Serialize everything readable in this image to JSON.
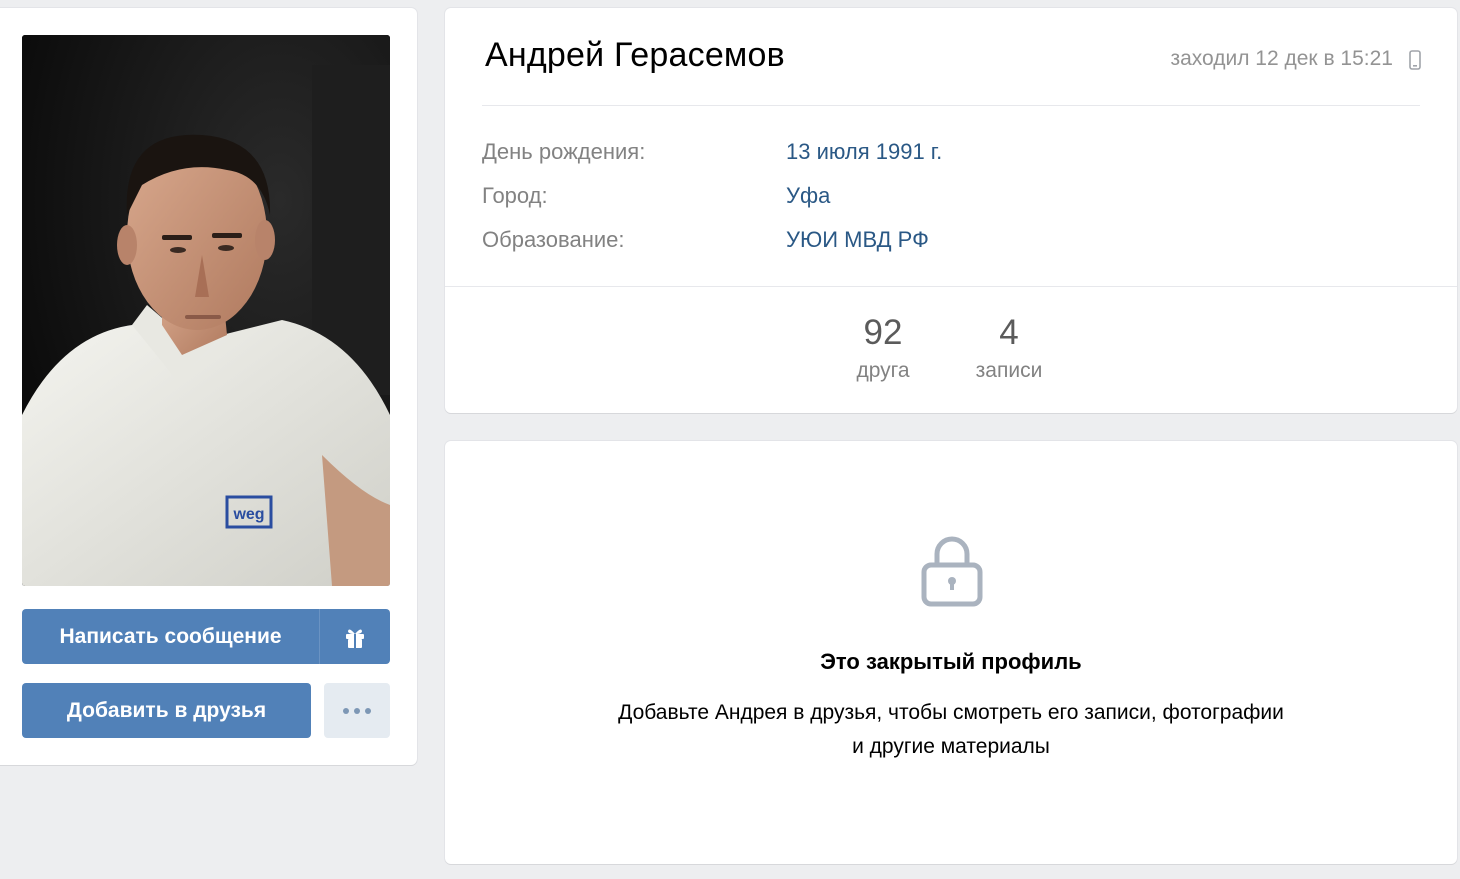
{
  "profile": {
    "name": "Андрей Герасемов",
    "last_seen": "заходил 12 дек в 15:21",
    "last_seen_device_icon": "mobile-phone-icon"
  },
  "info": [
    {
      "label": "День рождения:",
      "value": "13 июля 1991 г."
    },
    {
      "label": "Город:",
      "value": "Уфа"
    },
    {
      "label": "Образование:",
      "value": "УЮИ МВД РФ"
    }
  ],
  "counters": [
    {
      "value": "92",
      "label": "друга"
    },
    {
      "value": "4",
      "label": "записи"
    }
  ],
  "actions": {
    "message_label": "Написать сообщение",
    "gift_icon": "gift-icon",
    "add_friend_label": "Добавить в друзья",
    "more_icon": "more-dots-icon"
  },
  "photo": {
    "shirt_logo": "weg"
  },
  "closed": {
    "icon": "lock-icon",
    "title": "Это закрытый профиль",
    "text": "Добавьте Андрея в друзья, чтобы смотреть его записи, фотографии и другие материалы"
  },
  "colors": {
    "accent": "#5181b8",
    "link": "#2a5885",
    "background": "#edeef0"
  }
}
